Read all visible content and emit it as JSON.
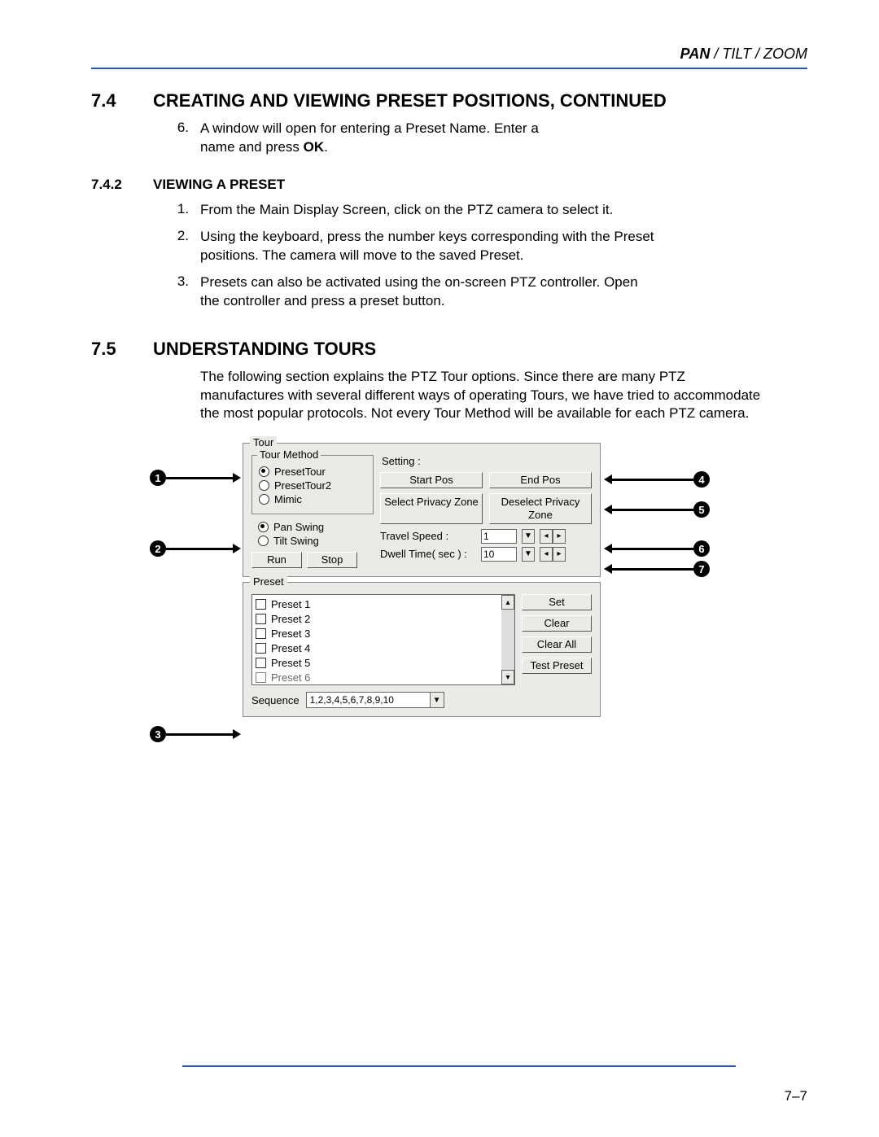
{
  "header": {
    "chapter_bold": "PAN",
    "chapter_rest": " / TILT / ZOOM"
  },
  "section_74": {
    "number": "7.4",
    "title": "CREATING AND VIEWING PRESET POSITIONS, CONTINUED",
    "step6_num": "6.",
    "step6_a": "A window will open for entering a Preset Name. Enter a name and press ",
    "step6_b": "OK",
    "step6_c": "."
  },
  "sub_742": {
    "number": "7.4.2",
    "title": "VIEWING A PRESET",
    "li1_num": "1.",
    "li1": "From the Main Display Screen, click on the PTZ camera to select it.",
    "li2_num": "2.",
    "li2": "Using the keyboard, press the number keys corresponding with the Preset positions. The camera will move to the saved Preset.",
    "li3_num": "3.",
    "li3": "Presets can also be activated using the on-screen PTZ controller. Open the controller and press a preset button."
  },
  "section_75": {
    "number": "7.5",
    "title": "UNDERSTANDING TOURS",
    "para": "The following section explains the PTZ Tour options. Since there are many PTZ manufactures with several different ways of operating Tours, we have tried to accommodate the most popular protocols. Not every Tour Method will be available for each PTZ camera."
  },
  "dialog": {
    "tour_legend": "Tour",
    "tour_method_legend": "Tour Method",
    "radio_presettour": "PresetTour",
    "radio_presettour2": "PresetTour2",
    "radio_mimic": "Mimic",
    "radio_panswing": "Pan Swing",
    "radio_tiltswing": "Tilt Swing",
    "btn_run": "Run",
    "btn_stop": "Stop",
    "setting_label": "Setting   :",
    "btn_startpos": "Start Pos",
    "btn_endpos": "End Pos",
    "btn_select_pz": "Select Privacy Zone",
    "btn_deselect_pz": "Deselect Privacy Zone",
    "lbl_travel": "Travel Speed  :",
    "val_travel": "1",
    "lbl_dwell": "Dwell Time( sec )  :",
    "val_dwell": "10",
    "preset_legend": "Preset",
    "presets": [
      "Preset 1",
      "Preset 2",
      "Preset 3",
      "Preset 4",
      "Preset 5",
      "Preset 6"
    ],
    "btn_set": "Set",
    "btn_clear": "Clear",
    "btn_clearall": "Clear All",
    "btn_testpreset": "Test Preset",
    "seq_label": "Sequence",
    "seq_value": "1,2,3,4,5,6,7,8,9,10"
  },
  "callouts": {
    "c1": "1",
    "c2": "2",
    "c3": "3",
    "c4": "4",
    "c5": "5",
    "c6": "6",
    "c7": "7"
  },
  "footer": {
    "pagenum": "7–7"
  }
}
